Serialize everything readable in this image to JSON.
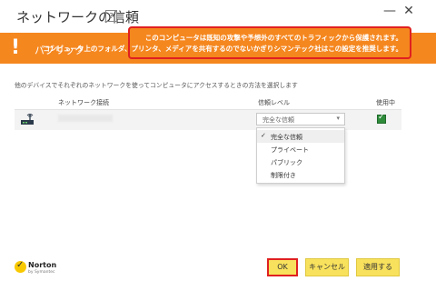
{
  "window": {
    "title": "ネットワークの信頼",
    "help_glyph": "?",
    "minimize_glyph": "—",
    "close_glyph": "✕"
  },
  "banner": {
    "warning_glyph": "!",
    "label": "パブリック",
    "color": "#f5871f"
  },
  "callout": {
    "line1": "このコンピュータは既知の攻撃や予想外のすべてのトラフィックから保護されます。",
    "line2": "コンピュータ上のフォルダ、プリンタ、メディアを共有するのでないかぎりシマンテック社はこの設定を推奨します。",
    "border_color": "#e02020"
  },
  "description": "他のデバイスでそれぞれのネットワークを使ってコンピュータにアクセスするときの方法を選択します",
  "table": {
    "headers": {
      "network": "ネットワーク接続",
      "trust_level": "信頼レベル",
      "in_use": "使用中"
    },
    "rows": [
      {
        "icon": "router-icon",
        "trust_level_value": "完全な信頼",
        "in_use_checked": true
      }
    ]
  },
  "dropdown": {
    "selected": "完全な信頼",
    "check_glyph": "✓",
    "arrow_glyph": "▾",
    "options": [
      "完全な信頼",
      "プライベート",
      "パブリック",
      "制限付き"
    ]
  },
  "footer": {
    "logo_check": "✓",
    "logo_name": "Norton",
    "logo_sub": "by Symantec",
    "ok_label": "OK",
    "cancel_label": "キャンセル",
    "apply_label": "適用する",
    "button_color": "#f8e15c"
  }
}
